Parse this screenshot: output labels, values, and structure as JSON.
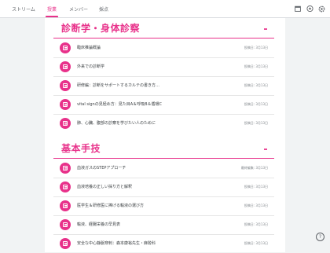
{
  "tabs": [
    {
      "label": "ストリーム",
      "active": false
    },
    {
      "label": "授業",
      "active": true
    },
    {
      "label": "メンバー",
      "active": false
    },
    {
      "label": "採点",
      "active": false
    }
  ],
  "toolbar_icons": [
    "calendar-icon",
    "drive-folder-icon",
    "settings-icon"
  ],
  "accent_color": "#e8318a",
  "sections": [
    {
      "title": "診断学・身体診察",
      "items": [
        {
          "title": "臨床推論概論",
          "date": "投稿日: 3月13日"
        },
        {
          "title": "外来での診断学",
          "date": "投稿日: 3月13日"
        },
        {
          "title": "研修編：診断をサポートするカルテの書き方…",
          "date": "投稿日: 3月13日"
        },
        {
          "title": "vital signの見極め方：見た目A＆呼吸B＆循環C",
          "date": "投稿日: 3月13日"
        },
        {
          "title": "肺、心臓、腹部の診察を学びたい人のために",
          "date": "投稿日: 3月13日"
        }
      ]
    },
    {
      "title": "基本手技",
      "items": [
        {
          "title": "血液ガスのSTEPアプローチ",
          "date": "最終編集: 3月13日"
        },
        {
          "title": "血液培養の正しい採り方と解釈",
          "date": "投稿日: 3月13日"
        },
        {
          "title": "医学生＆研修医に捧げる輸液の選び方",
          "date": "投稿日: 3月13日"
        },
        {
          "title": "輸液、経腸栄養の早見表",
          "date": "投稿日: 3月13日"
        },
        {
          "title": "安全な中心静脈穿刺：森本康裕先生・麻酔科",
          "date": "投稿日: 3月13日"
        }
      ]
    }
  ],
  "help_label": "?"
}
